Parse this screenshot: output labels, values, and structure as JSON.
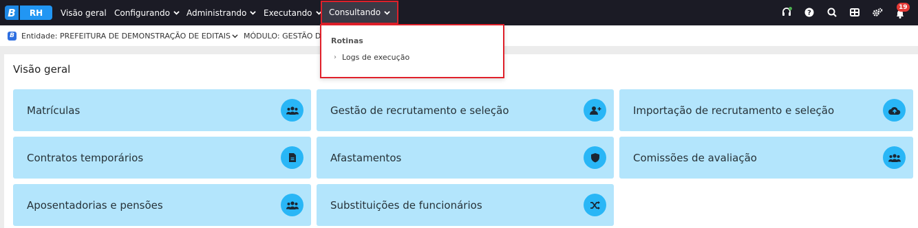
{
  "brand": {
    "letter": "B",
    "product": "RH"
  },
  "nav": {
    "items": [
      {
        "label": "Visão geral"
      },
      {
        "label": "Configurando"
      },
      {
        "label": "Administrando"
      },
      {
        "label": "Executando"
      },
      {
        "label": "Consultando"
      }
    ]
  },
  "header_icons": {
    "headset": "headset-icon",
    "help": "help-icon",
    "search": "search-icon",
    "apps": "apps-icon",
    "settings": "settings-icon",
    "notifications": "bell-icon",
    "notification_count": "19"
  },
  "context": {
    "entity_logo": "B",
    "entity": "Entidade: PREFEITURA DE DEMONSTRAÇÃO DE EDITAIS",
    "module": "MÓDULO: GESTÃO DE PE"
  },
  "dropdown": {
    "heading": "Rotinas",
    "items": [
      {
        "label": "Logs de execução"
      }
    ]
  },
  "overview": {
    "title": "Visão geral",
    "cards": [
      {
        "label": "Matrículas",
        "icon": "users-icon"
      },
      {
        "label": "Gestão de recrutamento e seleção",
        "icon": "user-plus-icon"
      },
      {
        "label": "Importação de recrutamento e seleção",
        "icon": "cloud-upload-icon"
      },
      {
        "label": "Contratos temporários",
        "icon": "file-icon"
      },
      {
        "label": "Afastamentos",
        "icon": "shield-icon"
      },
      {
        "label": "Comissões de avaliação",
        "icon": "users-icon"
      },
      {
        "label": "Aposentadorias e pensões",
        "icon": "users-icon"
      },
      {
        "label": "Substituições de funcionários",
        "icon": "shuffle-icon"
      }
    ]
  },
  "colors": {
    "topbar": "#1b1b25",
    "card_bg": "#b3e5fc",
    "card_icon_bg": "#29b6f6",
    "highlight": "#e0202a",
    "badge": "#e53935"
  }
}
